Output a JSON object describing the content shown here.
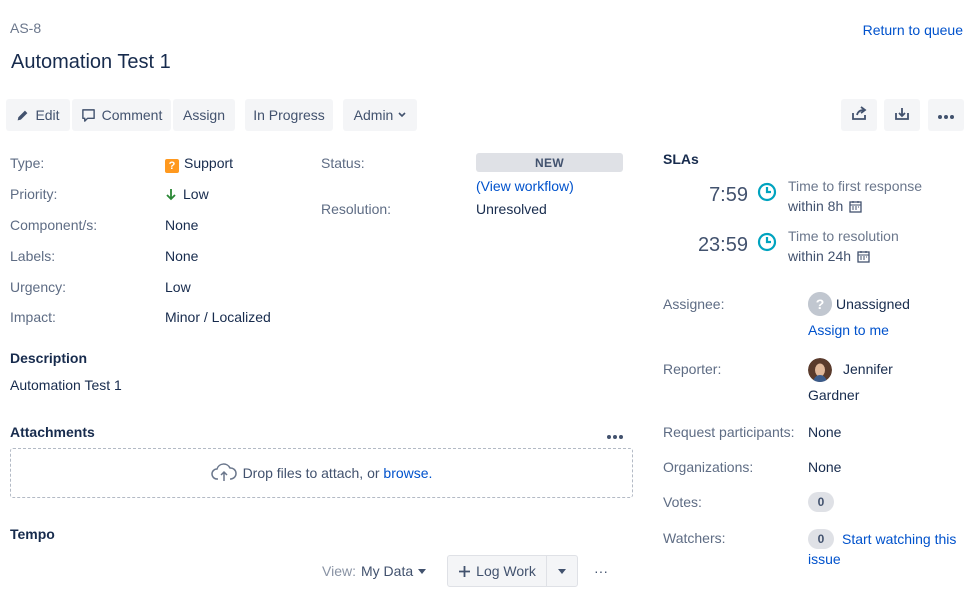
{
  "header": {
    "issue_key": "AS-8",
    "title": "Automation Test 1",
    "return_link": "Return to queue"
  },
  "toolbar": {
    "edit_label": "Edit",
    "comment_label": "Comment",
    "assign_label": "Assign",
    "in_progress_label": "In Progress",
    "admin_label": "Admin",
    "share_icon": "share-icon",
    "export_icon": "export-icon",
    "more_icon": "more-icon"
  },
  "details": {
    "type_label": "Type:",
    "type_value": "Support",
    "priority_label": "Priority:",
    "priority_value": "Low",
    "components_label": "Component/s:",
    "components_value": "None",
    "labels_label": "Labels:",
    "labels_value": "None",
    "urgency_label": "Urgency:",
    "urgency_value": "Low",
    "impact_label": "Impact:",
    "impact_value": "Minor / Localized",
    "status_label": "Status:",
    "status_value": "NEW",
    "view_workflow": "(View workflow)",
    "resolution_label": "Resolution:",
    "resolution_value": "Unresolved"
  },
  "description": {
    "heading": "Description",
    "text": "Automation Test 1"
  },
  "attachments": {
    "heading": "Attachments",
    "drop_text": "Drop files to attach, or ",
    "browse_link": "browse."
  },
  "tempo": {
    "heading": "Tempo",
    "view_label": "View:",
    "view_value": "My Data",
    "log_work": "Log Work",
    "more": "···"
  },
  "slas": {
    "heading": "SLAs",
    "items": [
      {
        "time": "7:59",
        "name": "Time to first response",
        "within": "within 8h"
      },
      {
        "time": "23:59",
        "name": "Time to resolution",
        "within": "within 24h"
      }
    ]
  },
  "people": {
    "assignee_label": "Assignee:",
    "assignee_value": "Unassigned",
    "assign_to_me": "Assign to me",
    "reporter_label": "Reporter:",
    "reporter_first": "Jennifer",
    "reporter_last": "Gardner",
    "participants_label": "Request participants:",
    "participants_value": "None",
    "organizations_label": "Organizations:",
    "organizations_value": "None",
    "votes_label": "Votes:",
    "votes_count": "0",
    "watchers_label": "Watchers:",
    "watchers_count": "0",
    "start_watching_1": "Start watching this",
    "start_watching_2": "issue"
  },
  "colors": {
    "link": "#0052cc",
    "sla_clock": "#00a3bf",
    "type_support": "#ff991f",
    "priority_low": "#2a8735"
  }
}
